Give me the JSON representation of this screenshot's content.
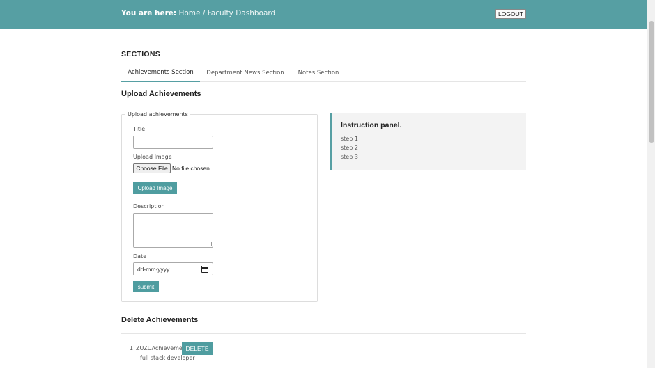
{
  "header": {
    "breadcrumb_prefix": "You are here:",
    "breadcrumb_path": "Home / Faculty Dashboard",
    "logout_label": "LOGOUT"
  },
  "sections": {
    "title": "SECTIONS",
    "tabs": [
      {
        "label": "Achievements Section",
        "active": true
      },
      {
        "label": "Department News Section",
        "active": false
      },
      {
        "label": "Notes Section",
        "active": false
      }
    ]
  },
  "upload": {
    "heading": "Upload Achievements",
    "legend": "Upload achievements",
    "title_label": "Title",
    "title_value": "",
    "image_label": "Upload Image",
    "choose_file_label": "Choose File",
    "file_status": "No file chosen",
    "upload_image_button": "Upload Image",
    "description_label": "Description",
    "description_value": "",
    "date_label": "Date",
    "date_placeholder": "dd-mm-yyyy",
    "submit_label": "submit"
  },
  "instruction_panel": {
    "title": "Instruction panel.",
    "steps": [
      "step 1",
      "step 2",
      "step 3"
    ]
  },
  "delete": {
    "heading": "Delete Achievements",
    "items": [
      {
        "number": "1.",
        "title": "ZUZUAchievement",
        "description": "full stack developer",
        "delete_label": "DELETE"
      }
    ]
  },
  "colors": {
    "header_bg": "#569fa3",
    "accent": "#4f9da0"
  },
  "icons": {
    "calendar": "calendar-icon"
  }
}
